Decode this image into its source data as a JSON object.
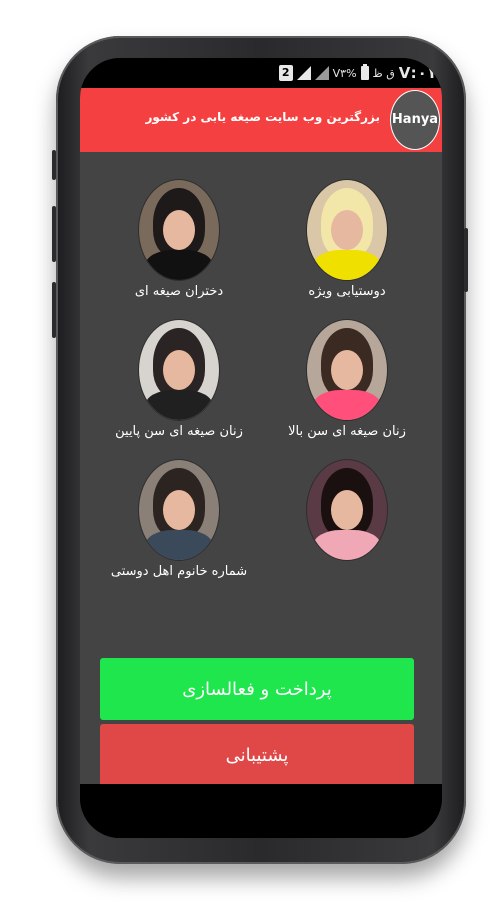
{
  "status_bar": {
    "sim": "2",
    "battery_text": "V۳%",
    "time": "V:۰۱",
    "extra": "ق ظ"
  },
  "app_bar": {
    "title": "بزرگترین وب سایت صیغه یابی در کشور",
    "badge": "Hanya"
  },
  "grid": {
    "items": [
      {
        "label": "دوستیابی ویژه"
      },
      {
        "label": "دختران صیغه ای"
      },
      {
        "label": "زنان صیغه ای سن بالا"
      },
      {
        "label": "زنان صیغه ای سن پایین"
      },
      {
        "label": ""
      },
      {
        "label": "شماره خانوم اهل دوستی"
      }
    ]
  },
  "buttons": {
    "pay": "پرداخت و فعالسازی",
    "support": "پشتیبانی"
  },
  "colors": {
    "app_bar": "#f44040",
    "background": "#444444",
    "pay_button": "#1ee64c",
    "support_button": "#e04848"
  }
}
